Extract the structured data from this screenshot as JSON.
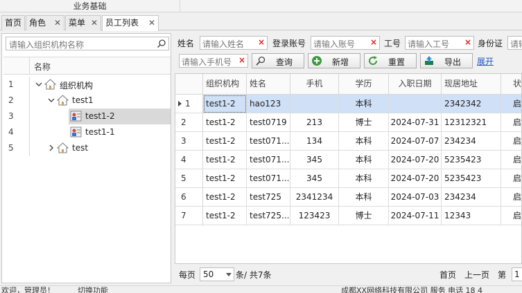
{
  "ribbon": {
    "group_label": "业务基础"
  },
  "tabs": [
    {
      "label": "首页"
    },
    {
      "label": "角色"
    },
    {
      "label": "菜单"
    },
    {
      "label": "员工列表"
    }
  ],
  "left_panel": {
    "search_placeholder": "请输入组织机构名称",
    "column_header": "名称",
    "rows": [
      {
        "num": "1",
        "label": "组织机构"
      },
      {
        "num": "2",
        "label": "test1"
      },
      {
        "num": "3",
        "label": "test1-2"
      },
      {
        "num": "4",
        "label": "test1-1"
      },
      {
        "num": "5",
        "label": "test"
      }
    ]
  },
  "filters": {
    "name_label": "姓名",
    "name_placeholder": "请输入姓名",
    "account_label": "登录账号",
    "account_placeholder": "请输入账号",
    "empno_label": "工号",
    "empno_placeholder": "请输入工号",
    "idcard_label": "身份证",
    "idcard_placeholder": "请输",
    "phone_placeholder": "请输入手机号"
  },
  "buttons": {
    "query": "查询",
    "add": "新增",
    "reset": "重置",
    "export": "导出",
    "expand": "展开"
  },
  "grid": {
    "headers": [
      "组织机构",
      "姓名",
      "手机",
      "学历",
      "入职日期",
      "现居地址",
      "状"
    ],
    "rows": [
      {
        "rn": "1",
        "org": "test1-2",
        "name": "hao123",
        "phone": "",
        "edu": "本科",
        "date": "",
        "addr": "2342342",
        "status": "启"
      },
      {
        "rn": "2",
        "org": "test1-2",
        "name": "test0719",
        "phone": "213",
        "edu": "博士",
        "date": "2024-07-31",
        "addr": "12312321",
        "status": "启"
      },
      {
        "rn": "3",
        "org": "test1-2",
        "name": "test071...",
        "phone": "134",
        "edu": "本科",
        "date": "2024-07-07",
        "addr": "234234",
        "status": "启"
      },
      {
        "rn": "4",
        "org": "test1-2",
        "name": "test071...",
        "phone": "345",
        "edu": "本科",
        "date": "2024-07-20",
        "addr": "5235423",
        "status": "启"
      },
      {
        "rn": "5",
        "org": "test1-2",
        "name": "test071...",
        "phone": "345",
        "edu": "本科",
        "date": "2024-07-20",
        "addr": "5235423",
        "status": "启"
      },
      {
        "rn": "6",
        "org": "test1-2",
        "name": "test725",
        "phone": "2341234",
        "edu": "本科",
        "date": "2024-07-03",
        "addr": "234234",
        "status": "启"
      },
      {
        "rn": "7",
        "org": "test1-2",
        "name": "test725...",
        "phone": "123423",
        "edu": "博士",
        "date": "2024-07-11",
        "addr": "12343",
        "status": "启"
      }
    ]
  },
  "pager": {
    "per_page_label": "每页",
    "per_page_value": "50",
    "total_label": "条/ 共7条",
    "first": "首页",
    "prev": "上一页",
    "page_label": "第",
    "page_value": "1"
  },
  "statusbar": {
    "left": "欢迎，管理员！",
    "switch": "切换功能",
    "right": "成都XX网络科技有限公司 服务 电话 18 4"
  },
  "colors": {
    "selected_row": "#cfe0f7",
    "accent_link": "#2257c4",
    "clear_icon": "#dd2222"
  }
}
